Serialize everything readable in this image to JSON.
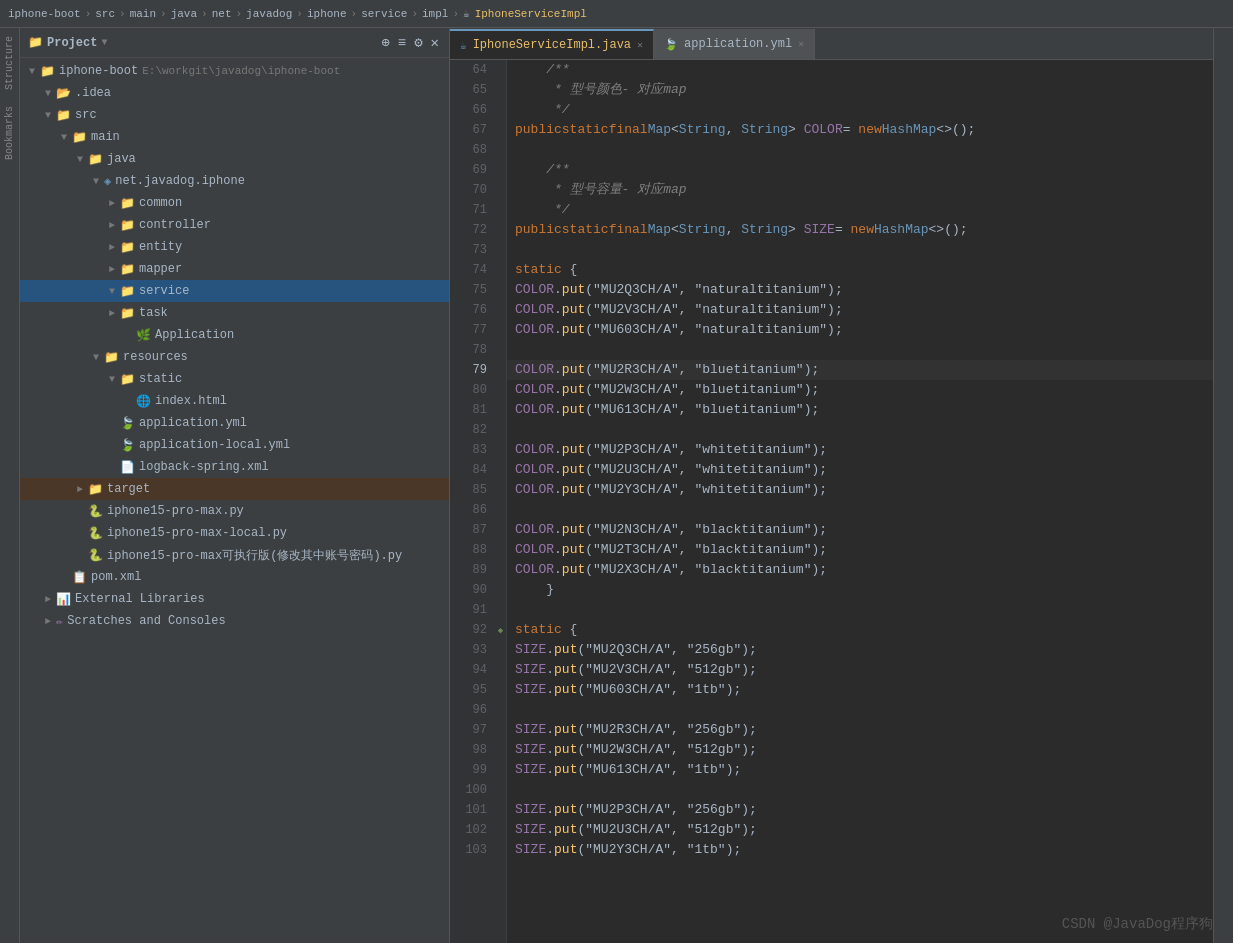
{
  "titleBar": {
    "breadcrumb": [
      "iphone-boot",
      "src",
      "main",
      "java",
      "net",
      "javadog",
      "iphone",
      "service",
      "impl",
      "IphoneServiceImpl"
    ],
    "separators": [
      ">",
      ">",
      ">",
      ">",
      ">",
      ">",
      ">",
      ">",
      ">"
    ]
  },
  "tabs": [
    {
      "label": "IphoneServiceImpl.java",
      "type": "java",
      "active": true
    },
    {
      "label": "application.yml",
      "type": "yaml",
      "active": false
    }
  ],
  "sidebar": {
    "title": "Project",
    "tree": [
      {
        "indent": 0,
        "arrow": "▼",
        "icon": "folder",
        "label": "iphone-boot",
        "path": "E:\\workgit\\javadog\\iphone-boot",
        "level": 0
      },
      {
        "indent": 1,
        "arrow": "▼",
        "icon": "idea",
        "label": ".idea",
        "level": 1
      },
      {
        "indent": 1,
        "arrow": "▼",
        "icon": "folder",
        "label": "src",
        "level": 1
      },
      {
        "indent": 2,
        "arrow": "▼",
        "icon": "folder",
        "label": "main",
        "level": 2
      },
      {
        "indent": 3,
        "arrow": "▼",
        "icon": "folder",
        "label": "java",
        "level": 3
      },
      {
        "indent": 4,
        "arrow": "▼",
        "icon": "package",
        "label": "net.javadog.iphone",
        "level": 4
      },
      {
        "indent": 5,
        "arrow": "►",
        "icon": "folder",
        "label": "common",
        "level": 5
      },
      {
        "indent": 5,
        "arrow": "►",
        "icon": "folder",
        "label": "controller",
        "level": 5
      },
      {
        "indent": 5,
        "arrow": "►",
        "icon": "folder",
        "label": "entity",
        "level": 5
      },
      {
        "indent": 5,
        "arrow": "►",
        "icon": "folder",
        "label": "mapper",
        "level": 5
      },
      {
        "indent": 5,
        "arrow": "▼",
        "icon": "folder",
        "label": "service",
        "level": 5,
        "selected": true
      },
      {
        "indent": 5,
        "arrow": "►",
        "icon": "folder",
        "label": "task",
        "level": 5
      },
      {
        "indent": 5,
        "arrow": "",
        "icon": "app",
        "label": "Application",
        "level": 5
      },
      {
        "indent": 4,
        "arrow": "▼",
        "icon": "folder",
        "label": "resources",
        "level": 4
      },
      {
        "indent": 5,
        "arrow": "▼",
        "icon": "folder",
        "label": "static",
        "level": 5
      },
      {
        "indent": 6,
        "arrow": "",
        "icon": "html",
        "label": "index.html",
        "level": 6
      },
      {
        "indent": 5,
        "arrow": "",
        "icon": "yaml",
        "label": "application.yml",
        "level": 5
      },
      {
        "indent": 5,
        "arrow": "",
        "icon": "yaml",
        "label": "application-local.yml",
        "level": 5
      },
      {
        "indent": 5,
        "arrow": "",
        "icon": "xml",
        "label": "logback-spring.xml",
        "level": 5
      },
      {
        "indent": 3,
        "arrow": "►",
        "icon": "folder",
        "label": "target",
        "level": 3
      },
      {
        "indent": 3,
        "arrow": "",
        "icon": "py",
        "label": "iphone15-pro-max.py",
        "level": 3
      },
      {
        "indent": 3,
        "arrow": "",
        "icon": "py",
        "label": "iphone15-pro-max-local.py",
        "level": 3
      },
      {
        "indent": 3,
        "arrow": "",
        "icon": "py",
        "label": "iphone15-pro-max可执行版(修改其中账号密码).py",
        "level": 3
      },
      {
        "indent": 2,
        "arrow": "",
        "icon": "xml",
        "label": "pom.xml",
        "level": 2
      },
      {
        "indent": 1,
        "arrow": "►",
        "icon": "folder",
        "label": "External Libraries",
        "level": 1
      },
      {
        "indent": 1,
        "arrow": "►",
        "icon": "scratches",
        "label": "Scratches and Consoles",
        "level": 1
      }
    ]
  },
  "codeLines": [
    {
      "num": 64,
      "gutter": "",
      "content": "    /**",
      "type": "comment"
    },
    {
      "num": 65,
      "gutter": "",
      "content": "     * 型号颜色- 对应map",
      "type": "comment"
    },
    {
      "num": 66,
      "gutter": "",
      "content": "     */",
      "type": "comment"
    },
    {
      "num": 67,
      "gutter": "",
      "content": "    public static final Map<String, String> COLOR= new HashMap<>();",
      "type": "code",
      "highlight": "COLOR="
    },
    {
      "num": 68,
      "gutter": "",
      "content": "",
      "type": "empty"
    },
    {
      "num": 69,
      "gutter": "",
      "content": "    /**",
      "type": "comment"
    },
    {
      "num": 70,
      "gutter": "",
      "content": "     * 型号容量- 对应map",
      "type": "comment"
    },
    {
      "num": 71,
      "gutter": "",
      "content": "     */",
      "type": "comment"
    },
    {
      "num": 72,
      "gutter": "",
      "content": "    public static final Map<String, String> SIZE= new HashMap<>();",
      "type": "code",
      "highlight": "SIZE="
    },
    {
      "num": 73,
      "gutter": "",
      "content": "",
      "type": "empty"
    },
    {
      "num": 74,
      "gutter": "",
      "content": "    static {",
      "type": "code"
    },
    {
      "num": 75,
      "gutter": "",
      "content": "        COLOR.put(\"MU2Q3CH/A\", \"naturaltitanium\");",
      "type": "code"
    },
    {
      "num": 76,
      "gutter": "",
      "content": "        COLOR.put(\"MU2V3CH/A\", \"naturaltitanium\");",
      "type": "code"
    },
    {
      "num": 77,
      "gutter": "",
      "content": "        COLOR.put(\"MU603CH/A\", \"naturaltitanium\");",
      "type": "code"
    },
    {
      "num": 78,
      "gutter": "",
      "content": "",
      "type": "empty"
    },
    {
      "num": 79,
      "gutter": "",
      "content": "        COLOR.put(\"MU2R3CH/A\", \"bluetitanium\");",
      "type": "code",
      "current": true
    },
    {
      "num": 80,
      "gutter": "",
      "content": "        COLOR.put(\"MU2W3CH/A\", \"bluetitanium\");",
      "type": "code"
    },
    {
      "num": 81,
      "gutter": "",
      "content": "        COLOR.put(\"MU613CH/A\", \"bluetitanium\");",
      "type": "code"
    },
    {
      "num": 82,
      "gutter": "",
      "content": "",
      "type": "empty"
    },
    {
      "num": 83,
      "gutter": "",
      "content": "        COLOR.put(\"MU2P3CH/A\", \"whitetitanium\");",
      "type": "code"
    },
    {
      "num": 84,
      "gutter": "",
      "content": "        COLOR.put(\"MU2U3CH/A\", \"whitetitanium\");",
      "type": "code"
    },
    {
      "num": 85,
      "gutter": "",
      "content": "        COLOR.put(\"MU2Y3CH/A\", \"whitetitanium\");",
      "type": "code"
    },
    {
      "num": 86,
      "gutter": "",
      "content": "",
      "type": "empty"
    },
    {
      "num": 87,
      "gutter": "",
      "content": "        COLOR.put(\"MU2N3CH/A\", \"blacktitanium\");",
      "type": "code"
    },
    {
      "num": 88,
      "gutter": "",
      "content": "        COLOR.put(\"MU2T3CH/A\", \"blacktitanium\");",
      "type": "code"
    },
    {
      "num": 89,
      "gutter": "",
      "content": "        COLOR.put(\"MU2X3CH/A\", \"blacktitanium\");",
      "type": "code"
    },
    {
      "num": 90,
      "gutter": "",
      "content": "    }",
      "type": "code"
    },
    {
      "num": 91,
      "gutter": "",
      "content": "",
      "type": "empty"
    },
    {
      "num": 92,
      "gutter": "◆",
      "content": "    static {",
      "type": "code"
    },
    {
      "num": 93,
      "gutter": "",
      "content": "        SIZE.put(\"MU2Q3CH/A\", \"256gb\");",
      "type": "code"
    },
    {
      "num": 94,
      "gutter": "",
      "content": "        SIZE.put(\"MU2V3CH/A\", \"512gb\");",
      "type": "code"
    },
    {
      "num": 95,
      "gutter": "",
      "content": "        SIZE.put(\"MU603CH/A\", \"1tb\");",
      "type": "code"
    },
    {
      "num": 96,
      "gutter": "",
      "content": "",
      "type": "empty"
    },
    {
      "num": 97,
      "gutter": "",
      "content": "        SIZE.put(\"MU2R3CH/A\", \"256gb\");",
      "type": "code"
    },
    {
      "num": 98,
      "gutter": "",
      "content": "        SIZE.put(\"MU2W3CH/A\", \"512gb\");",
      "type": "code"
    },
    {
      "num": 99,
      "gutter": "",
      "content": "        SIZE.put(\"MU613CH/A\", \"1tb\");",
      "type": "code"
    },
    {
      "num": 100,
      "gutter": "",
      "content": "",
      "type": "empty"
    },
    {
      "num": 101,
      "gutter": "",
      "content": "        SIZE.put(\"MU2P3CH/A\", \"256gb\");",
      "type": "code"
    },
    {
      "num": 102,
      "gutter": "",
      "content": "        SIZE.put(\"MU2U3CH/A\", \"512gb\");",
      "type": "code"
    },
    {
      "num": 103,
      "gutter": "",
      "content": "        SIZE.put(\"MU2Y3CH/A\", \"1tb\");",
      "type": "code"
    }
  ],
  "verticalTabs": {
    "left": [
      "Structure",
      "Bookmarks"
    ]
  },
  "watermark": "CSDN @JavaDog程序狗"
}
